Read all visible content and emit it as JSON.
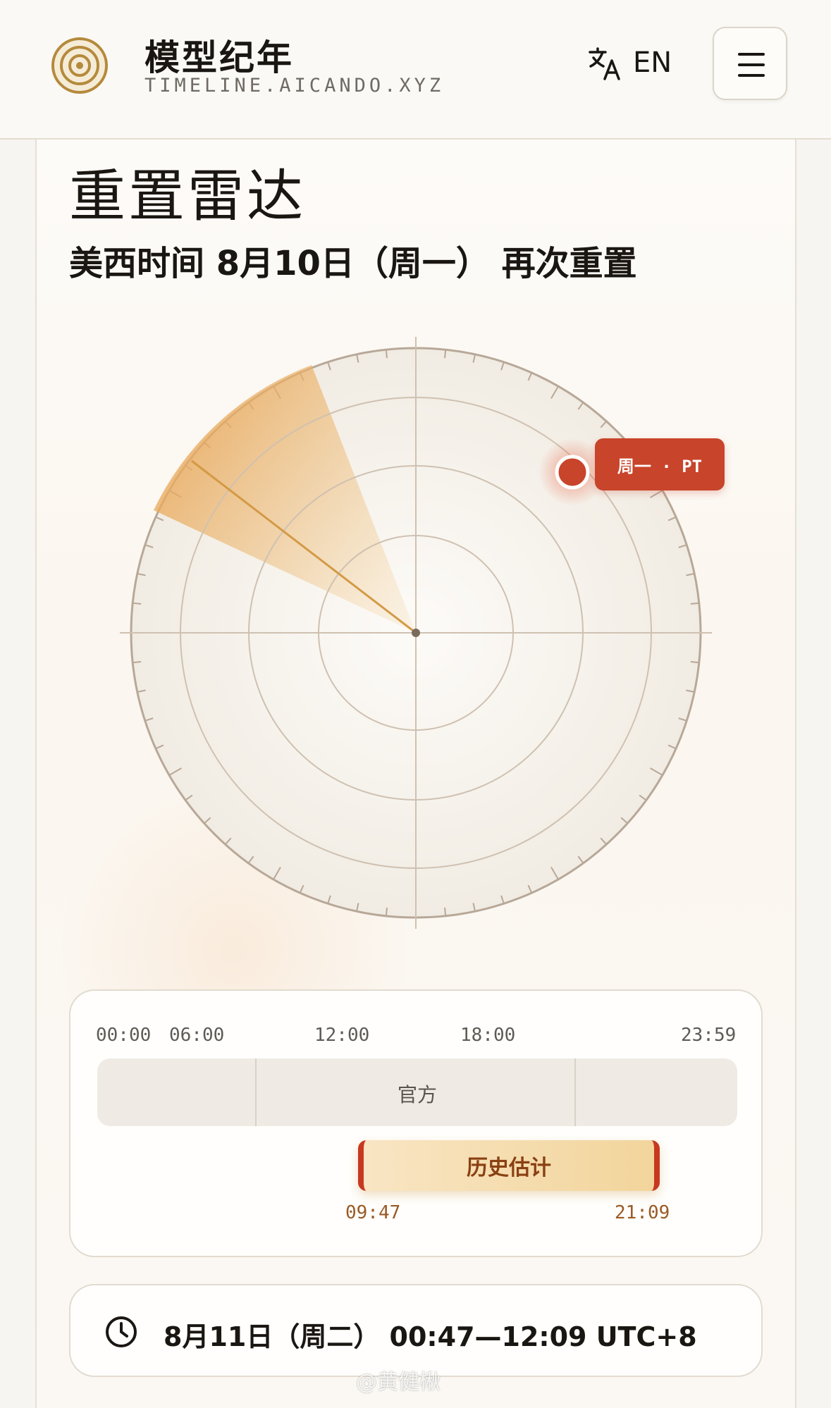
{
  "header": {
    "title": "模型纪年",
    "subtitle": "TIMELINE.AICANDO.XYZ",
    "lang_label": "EN",
    "icons": {
      "logo": "concentric-circles-logo",
      "translate": "translate-icon",
      "menu": "hamburger-menu-icon"
    }
  },
  "page": {
    "title": "重置雷达",
    "subtitle": "美西时间 8月10日（周一） 再次重置"
  },
  "radar": {
    "marker_label": "周一 · PT"
  },
  "timeline": {
    "ticks": [
      "00:00",
      "06:00",
      "12:00",
      "18:00",
      "23:59"
    ],
    "official_label": "官方",
    "estimate_label": "历史估计",
    "estimate_start": "09:47",
    "estimate_end": "21:09"
  },
  "local_time": {
    "text": "8月11日（周二） 00:47—12:09 UTC+8",
    "icon": "clock-icon"
  },
  "watermark": "@黄健楸",
  "colors": {
    "accent_red": "#c8442a",
    "gold": "#c9944a",
    "background": "#f7f5f1"
  }
}
